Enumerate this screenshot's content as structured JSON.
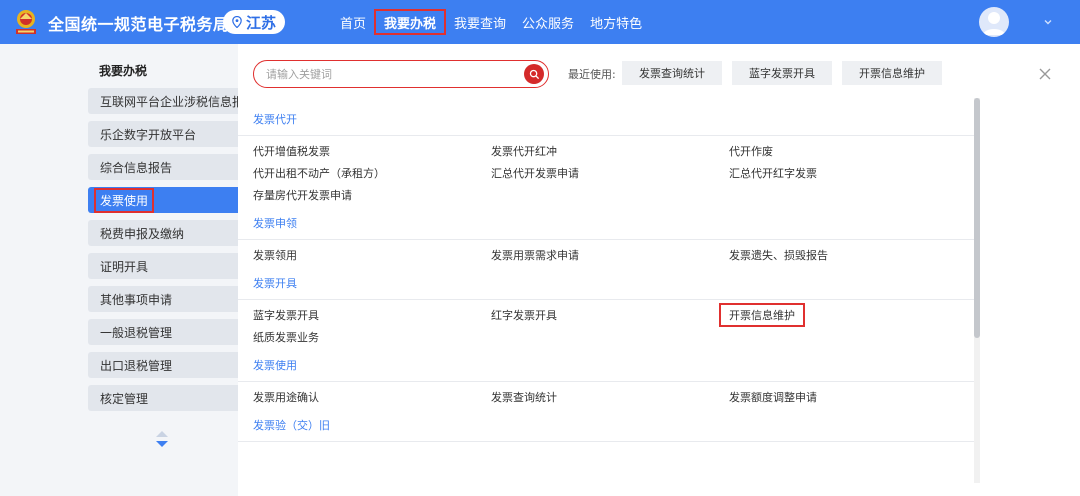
{
  "header": {
    "brand": "全国统一规范电子税务局",
    "region": "江苏",
    "nav": [
      {
        "label": "首页",
        "active": false
      },
      {
        "label": "我要办税",
        "active": true
      },
      {
        "label": "我要查询",
        "active": false
      },
      {
        "label": "公众服务",
        "active": false
      },
      {
        "label": "地方特色",
        "active": false
      }
    ],
    "colors": {
      "bar": "#3d7ff1",
      "highlight": "#e0302f"
    }
  },
  "sidebar": {
    "title": "我要办税",
    "items": [
      {
        "label": "互联网平台企业涉税信息报送"
      },
      {
        "label": "乐企数字开放平台"
      },
      {
        "label": "综合信息报告"
      },
      {
        "label": "发票使用",
        "active": true
      },
      {
        "label": "税费申报及缴纳"
      },
      {
        "label": "证明开具"
      },
      {
        "label": "其他事项申请"
      },
      {
        "label": "一般退税管理"
      },
      {
        "label": "出口退税管理"
      },
      {
        "label": "核定管理"
      }
    ]
  },
  "search": {
    "placeholder": "请输入关键词"
  },
  "recent": {
    "label": "最近使用:",
    "items": [
      "发票查询统计",
      "蓝字发票开具",
      "开票信息维护"
    ]
  },
  "sections": [
    {
      "title": "发票代开",
      "items": [
        "代开增值税发票",
        "发票代开红冲",
        "代开作废",
        "代开出租不动产（承租方）",
        "汇总代开发票申请",
        "汇总代开红字发票",
        "存量房代开发票申请"
      ]
    },
    {
      "title": "发票申领",
      "items": [
        "发票领用",
        "发票用票需求申请",
        "发票遗失、损毁报告"
      ]
    },
    {
      "title": "发票开具",
      "items": [
        "蓝字发票开具",
        "红字发票开具",
        "开票信息维护",
        "纸质发票业务"
      ],
      "highlight": 2
    },
    {
      "title": "发票使用",
      "items": [
        "发票用途确认",
        "发票查询统计",
        "发票额度调整申请"
      ]
    },
    {
      "title": "发票验（交）旧",
      "items": []
    }
  ]
}
